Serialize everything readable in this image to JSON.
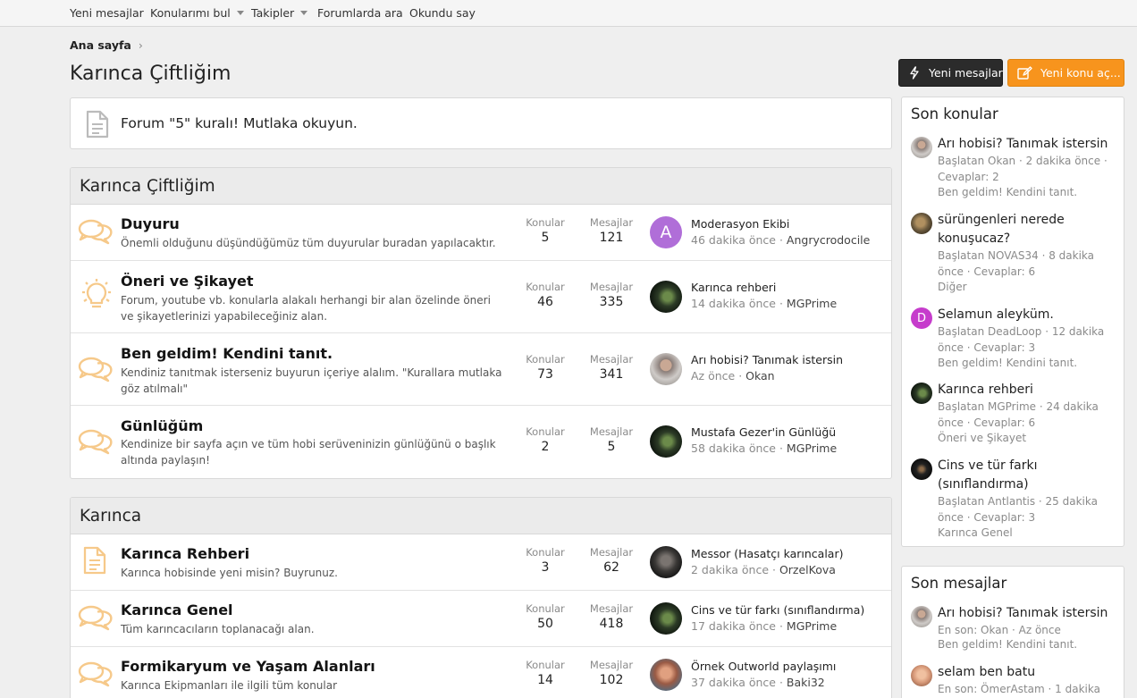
{
  "topnav": {
    "items": [
      {
        "label": "Yeni mesajlar",
        "has_caret": false
      },
      {
        "label": "Konularımı bul",
        "has_caret": true
      },
      {
        "label": "Takipler",
        "has_caret": true
      },
      {
        "label": "Forumlarda ara",
        "has_caret": false
      },
      {
        "label": "Okundu say",
        "has_caret": false
      }
    ]
  },
  "breadcrumb": {
    "home": "Ana sayfa"
  },
  "page": {
    "title": "Karınca Çiftliğim"
  },
  "buttons": {
    "new_posts": "Yeni mesajlar",
    "new_thread": "Yeni konu aç..."
  },
  "notice": {
    "text": "Forum \"5\" kuralı! Mutlaka okuyun."
  },
  "labels": {
    "threads": "Konular",
    "messages": "Mesajlar"
  },
  "categories": [
    {
      "title": "Karınca Çiftliğim",
      "forums": [
        {
          "icon": "chat-bubbles-icon",
          "title": "Duyuru",
          "desc": "Önemli olduğunu düşündüğümüz tüm duyurular buradan yapılacaktır.",
          "threads": "5",
          "messages": "121",
          "avatar": "A",
          "avatar_color": "#b06ed8",
          "last_title": "Moderasyon Ekibi",
          "last_time": "46 dakika önce",
          "last_user": "Angrycrodocile"
        },
        {
          "icon": "lightbulb-icon",
          "title": "Öneri ve Şikayet",
          "desc": "Forum, youtube vb. konularla alakalı herhangi bir alan özelinde öneri ve şikayetlerinizi yapabileceğiniz alan.",
          "threads": "46",
          "messages": "335",
          "avatar": "",
          "avatar_color": "#1c2a1c",
          "last_title": "Karınca rehberi",
          "last_time": "14 dakika önce",
          "last_user": "MGPrime"
        },
        {
          "icon": "chat-bubbles-icon",
          "title": "Ben geldim! Kendini tanıt.",
          "desc": "Kendiniz tanıtmak isterseniz buyurun içeriye alalım. \"Kurallara mutlaka göz atılmalı\"",
          "threads": "73",
          "messages": "341",
          "avatar": "",
          "avatar_color": "#9a8c86",
          "last_title": "Arı hobisi? Tanımak istersin",
          "last_time": "Az önce",
          "last_user": "Okan"
        },
        {
          "icon": "chat-bubbles-icon",
          "title": "Günlüğüm",
          "desc": "Kendinize bir sayfa açın ve tüm hobi serüveninizin günlüğünü o başlık altında paylaşın!",
          "threads": "2",
          "messages": "5",
          "avatar": "",
          "avatar_color": "#1c2a1c",
          "last_title": "Mustafa Gezer'in Günlüğü",
          "last_time": "58 dakika önce",
          "last_user": "MGPrime"
        }
      ]
    },
    {
      "title": "Karınca",
      "forums": [
        {
          "icon": "document-icon",
          "title": "Karınca Rehberi",
          "desc": "Karınca hobisinde yeni misin? Buyrunuz.",
          "threads": "3",
          "messages": "62",
          "avatar": "",
          "avatar_color": "#2a2a2a",
          "last_title": "Messor (Hasatçı karıncalar)",
          "last_time": "2 dakika önce",
          "last_user": "OrzelKova"
        },
        {
          "icon": "chat-bubbles-icon",
          "title": "Karınca Genel",
          "desc": "Tüm karıncacıların toplanacağı alan.",
          "threads": "50",
          "messages": "418",
          "avatar": "",
          "avatar_color": "#1c2a1c",
          "last_title": "Cins ve tür farkı (sınıflandırma)",
          "last_time": "17 dakika önce",
          "last_user": "MGPrime"
        },
        {
          "icon": "chat-bubbles-icon",
          "title": "Formikaryum ve Yaşam Alanları",
          "desc": "Karınca Ekipmanları ile ilgili tüm konular",
          "threads": "14",
          "messages": "102",
          "avatar": "",
          "avatar_color": "#b87a5a",
          "last_title": "Örnek Outworld paylaşımı",
          "last_time": "37 dakika önce",
          "last_user": "Baki32"
        }
      ]
    }
  ],
  "sidebar": {
    "recent_threads": {
      "title": "Son konular",
      "items": [
        {
          "title": "Arı hobisi? Tanımak istersin",
          "meta": "Başlatan Okan · 2 dakika önce · Cevaplar: 2",
          "forum": "Ben geldim! Kendini tanıt.",
          "avatar": "",
          "avatar_color": "#9a8c86"
        },
        {
          "title": "sürüngenleri nerede konuşucaz?",
          "meta": "Başlatan NOVAS34 · 8 dakika önce · Cevaplar: 6",
          "forum": "Diğer",
          "avatar": "",
          "avatar_color": "#6b5a3e"
        },
        {
          "title": "Selamun aleyküm.",
          "meta": "Başlatan DeadLoop · 12 dakika önce · Cevaplar: 3",
          "forum": "Ben geldim! Kendini tanıt.",
          "avatar": "D",
          "avatar_color": "#c63ccc"
        },
        {
          "title": "Karınca rehberi",
          "meta": "Başlatan MGPrime · 24 dakika önce · Cevaplar: 6",
          "forum": "Öneri ve Şikayet",
          "avatar": "",
          "avatar_color": "#1c2a1c"
        },
        {
          "title": "Cins ve tür farkı (sınıflandırma)",
          "meta": "Başlatan Antlantis · 25 dakika önce · Cevaplar: 3",
          "forum": "Karınca Genel",
          "avatar": "",
          "avatar_color": "#111111"
        }
      ]
    },
    "recent_posts": {
      "title": "Son mesajlar",
      "items": [
        {
          "title": "Arı hobisi? Tanımak istersin",
          "meta": "En son: Okan · Az önce",
          "forum": "Ben geldim! Kendini tanıt.",
          "avatar": "",
          "avatar_color": "#9a8c86"
        },
        {
          "title": "selam ben batu",
          "meta": "En son: ÖmerAstam · 1 dakika",
          "forum": "",
          "avatar": "",
          "avatar_color": "#d89a7a"
        }
      ]
    }
  },
  "colors": {
    "accent": "#f7941d",
    "icon": "#f6c98a",
    "dark_button": "#2b2b2b"
  }
}
